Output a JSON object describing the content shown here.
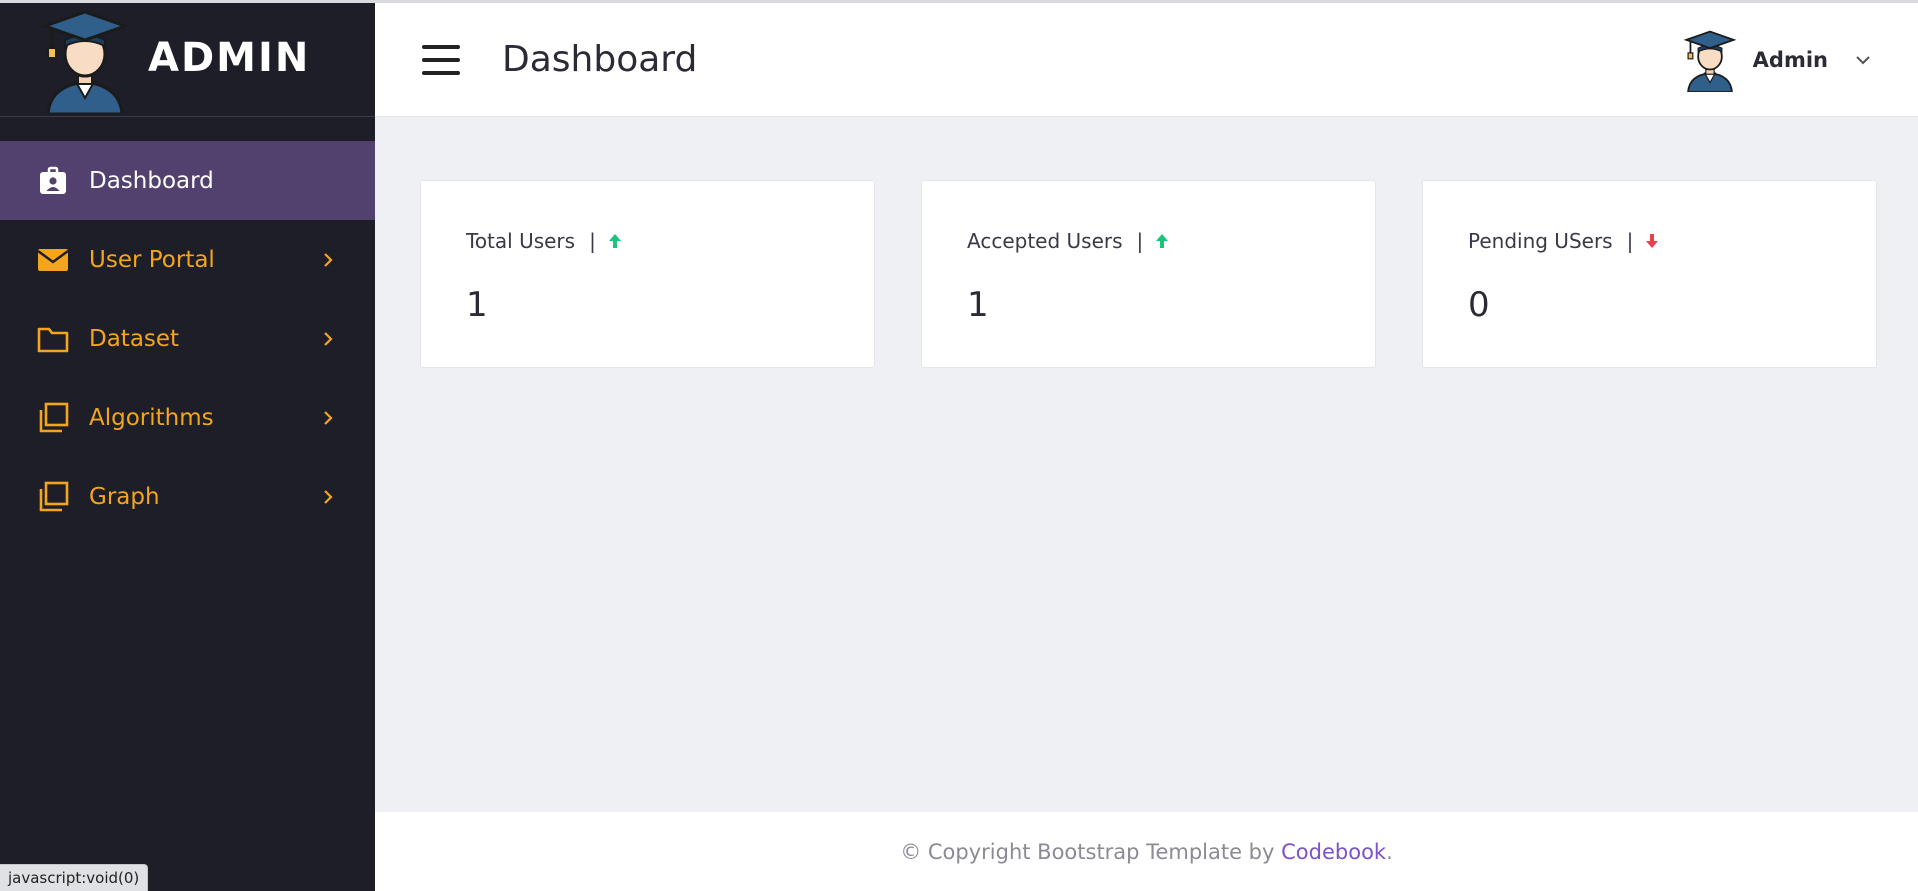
{
  "brand": {
    "title": "ADMIN"
  },
  "sidebar": {
    "items": [
      {
        "label": "Dashboard",
        "icon": "id-badge-icon",
        "active": true
      },
      {
        "label": "User Portal",
        "icon": "envelope-icon",
        "active": false
      },
      {
        "label": "Dataset",
        "icon": "folder-icon",
        "active": false
      },
      {
        "label": "Algorithms",
        "icon": "copy-icon",
        "active": false
      },
      {
        "label": "Graph",
        "icon": "copy-icon",
        "active": false
      }
    ]
  },
  "header": {
    "title": "Dashboard",
    "user_name": "Admin"
  },
  "cards": [
    {
      "label": "Total Users",
      "separator": "|",
      "trend": "up",
      "trend_color": "#1bc47d",
      "value": "1"
    },
    {
      "label": "Accepted Users",
      "separator": "|",
      "trend": "up",
      "trend_color": "#1bc47d",
      "value": "1"
    },
    {
      "label": "Pending USers",
      "separator": "|",
      "trend": "down",
      "trend_color": "#e8414d",
      "value": "0"
    }
  ],
  "footer": {
    "prefix": "© Copyright Bootstrap Template by ",
    "link": "Codebook",
    "suffix": "."
  },
  "statusbar": {
    "text": "javascript:void(0)"
  },
  "colors": {
    "sidebar_bg": "#1d1e27",
    "active_bg": "#52406f",
    "nav_text": "#f4a51c",
    "link": "#7b52c9"
  }
}
